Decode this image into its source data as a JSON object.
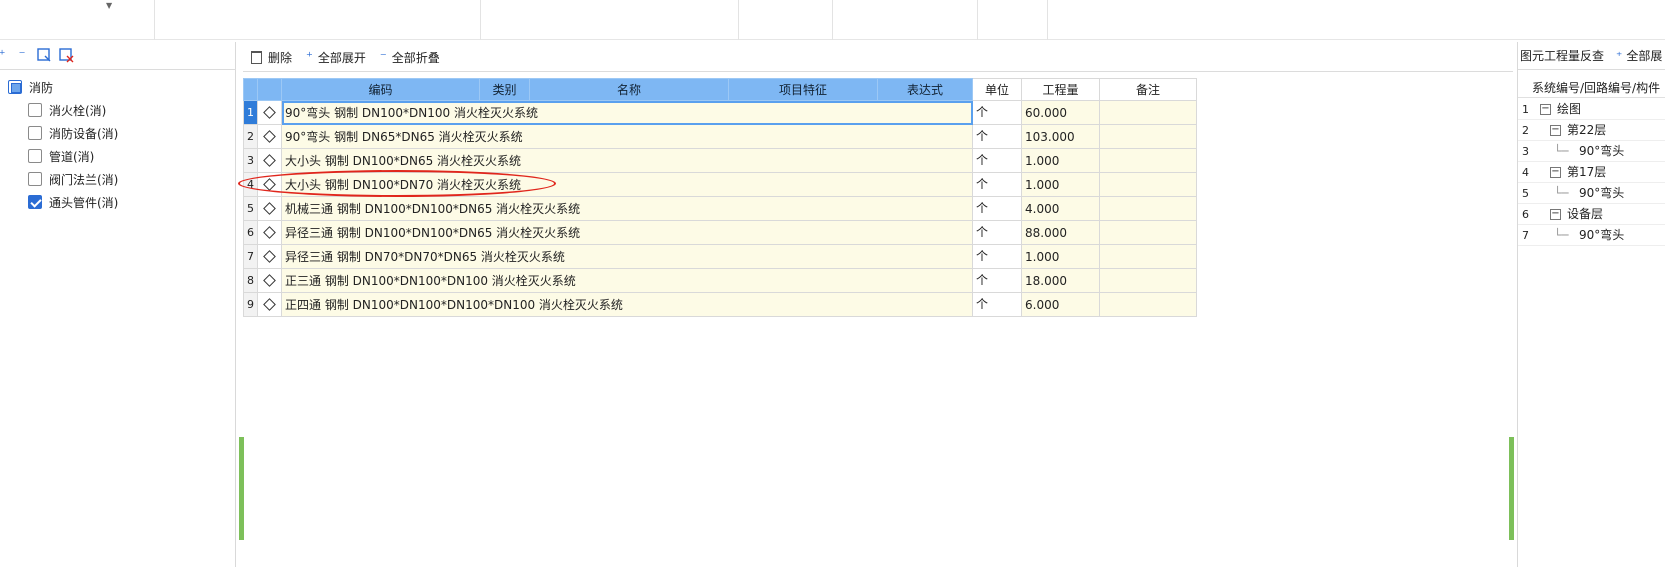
{
  "left_tree": {
    "root_label": "消防",
    "items": [
      {
        "label": "消火栓(消)",
        "checked": false
      },
      {
        "label": "消防设备(消)",
        "checked": false
      },
      {
        "label": "管道(消)",
        "checked": false
      },
      {
        "label": "阀门法兰(消)",
        "checked": false
      },
      {
        "label": "通头管件(消)",
        "checked": true
      }
    ]
  },
  "toolbar": {
    "delete_label": "删除",
    "expand_all_label": "全部展开",
    "collapse_all_label": "全部折叠"
  },
  "grid": {
    "headers": {
      "code": "编码",
      "category": "类别",
      "name": "名称",
      "feature": "项目特征",
      "expression": "表达式",
      "unit": "单位",
      "quantity": "工程量",
      "note": "备注"
    },
    "rows": [
      {
        "n": "1",
        "name": "90°弯头 钢制 DN100*DN100 消火栓灭火系统",
        "unit": "个",
        "qty": "60.000"
      },
      {
        "n": "2",
        "name": "90°弯头 钢制 DN65*DN65 消火栓灭火系统",
        "unit": "个",
        "qty": "103.000"
      },
      {
        "n": "3",
        "name": "大小头 钢制 DN100*DN65 消火栓灭火系统",
        "unit": "个",
        "qty": "1.000"
      },
      {
        "n": "4",
        "name": "大小头 钢制 DN100*DN70 消火栓灭火系统",
        "unit": "个",
        "qty": "1.000"
      },
      {
        "n": "5",
        "name": "机械三通 钢制 DN100*DN100*DN65 消火栓灭火系统",
        "unit": "个",
        "qty": "4.000"
      },
      {
        "n": "6",
        "name": "异径三通 钢制 DN100*DN100*DN65 消火栓灭火系统",
        "unit": "个",
        "qty": "88.000"
      },
      {
        "n": "7",
        "name": "异径三通 钢制 DN70*DN70*DN65 消火栓灭火系统",
        "unit": "个",
        "qty": "1.000"
      },
      {
        "n": "8",
        "name": "正三通 钢制 DN100*DN100*DN100 消火栓灭火系统",
        "unit": "个",
        "qty": "18.000"
      },
      {
        "n": "9",
        "name": "正四通 钢制 DN100*DN100*DN100*DN100 消火栓灭火系统",
        "unit": "个",
        "qty": "6.000"
      }
    ]
  },
  "right_panel": {
    "title": "图元工程量反查",
    "expand_all_label": "全部展",
    "column_header": "系统编号/回路编号/构件",
    "rows": [
      {
        "n": "1",
        "label": "绘图",
        "level": 0,
        "toggle": true
      },
      {
        "n": "2",
        "label": "第22层",
        "level": 1,
        "toggle": true
      },
      {
        "n": "3",
        "label": "90°弯头",
        "level": 2,
        "toggle": false
      },
      {
        "n": "4",
        "label": "第17层",
        "level": 1,
        "toggle": true
      },
      {
        "n": "5",
        "label": "90°弯头",
        "level": 2,
        "toggle": false
      },
      {
        "n": "6",
        "label": "设备层",
        "level": 1,
        "toggle": true
      },
      {
        "n": "7",
        "label": "90°弯头",
        "level": 2,
        "toggle": false
      }
    ]
  },
  "colors": {
    "header_blue": "#7eb7f3",
    "row_yellow": "#fdfbe6",
    "selection_blue": "#2f7cd9",
    "annotation_red": "#e0261c",
    "splitter_green": "#7dc05a"
  },
  "icons": [
    "expand-icon",
    "collapse-icon",
    "select-icon",
    "deselect-icon",
    "trash-icon",
    "diamond-icon",
    "checkbox-icon"
  ]
}
